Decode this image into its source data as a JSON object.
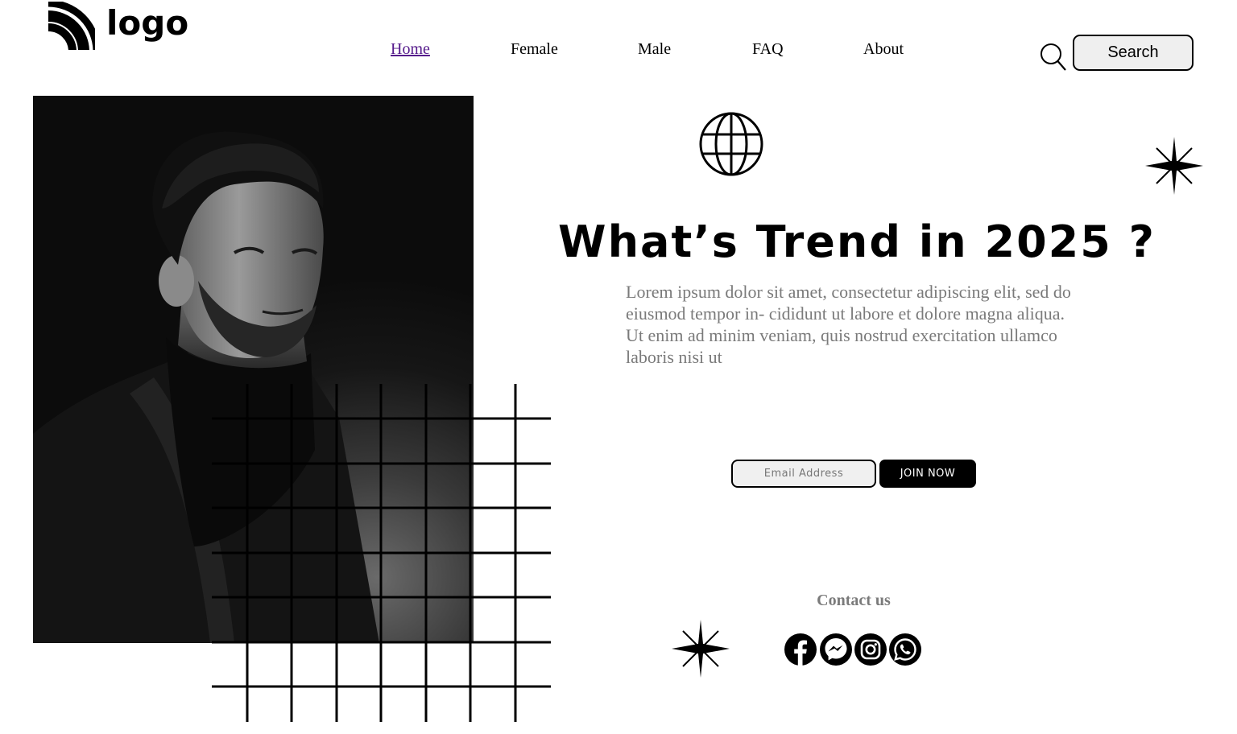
{
  "brand": {
    "logo_text": "logo",
    "logo_icon": "rss-arcs-icon"
  },
  "nav": {
    "items": [
      {
        "label": "Home",
        "active": true
      },
      {
        "label": "Female",
        "active": false
      },
      {
        "label": "Male",
        "active": false
      },
      {
        "label": "FAQ",
        "active": false
      },
      {
        "label": "About",
        "active": false
      }
    ],
    "search_icon": "magnifier-icon",
    "search_label": "Search"
  },
  "hero": {
    "image": "black-and-white portrait of a man in a dark turtleneck and blazer",
    "headline": "What’s Trend in 2025 ?",
    "intro": "Lorem ipsum dolor sit amet, consectetur adipiscing elit, sed do eiusmod tempor in- cididunt ut labore et dolore magna aliqua. Ut enim ad minim veniam, quis nostrud exercitation ullamco laboris nisi ut",
    "decor_icons": [
      "globe-icon",
      "sparkle-icon",
      "grid-lines"
    ]
  },
  "signup": {
    "email_placeholder": "Email Address",
    "email_value": "",
    "join_label": "JOIN NOW"
  },
  "contact": {
    "title": "Contact us",
    "socials": [
      "facebook-icon",
      "messenger-icon",
      "instagram-icon",
      "whatsapp-icon"
    ]
  },
  "colors": {
    "text": "#000000",
    "muted": "#7a7a7a",
    "link_active": "#551a8b",
    "button_bg": "#efefef",
    "join_bg": "#000000"
  }
}
